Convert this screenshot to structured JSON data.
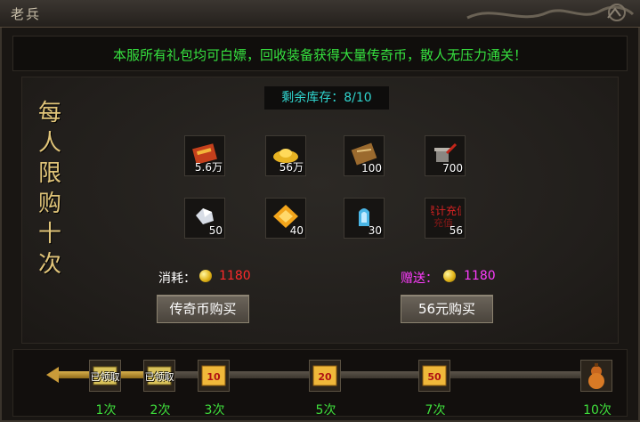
{
  "window": {
    "title": "老兵"
  },
  "notice": "本服所有礼包均可白嫖，回收装备获得大量传奇币，散人无压力通关！",
  "side_text": [
    "每",
    "人",
    "限",
    "购",
    "十",
    "次"
  ],
  "stock": {
    "label": "剩余库存：",
    "value": "8/10"
  },
  "items": [
    {
      "icon": "gift-scroll-icon",
      "qty": "5.6万"
    },
    {
      "icon": "gold-ingot-icon",
      "qty": "56万"
    },
    {
      "icon": "book-icon",
      "qty": "100"
    },
    {
      "icon": "anvil-icon",
      "qty": "700"
    },
    {
      "icon": "silver-crystal-icon",
      "qty": "50"
    },
    {
      "icon": "gold-gem-icon",
      "qty": "40"
    },
    {
      "icon": "blue-rune-icon",
      "qty": "30"
    },
    {
      "icon": "recharge-seal-icon",
      "qty": "56",
      "seal_text": "累计充值"
    }
  ],
  "cost": {
    "label": "消耗：",
    "value": "1180",
    "color": "#ff2a2a"
  },
  "bonus": {
    "label": "赠送：",
    "value": "1180",
    "color": "#ff3cff"
  },
  "buttons": {
    "buy_coin": "传奇币购买",
    "buy_cash": "56元购买"
  },
  "progress": {
    "filled_fraction": 0.2,
    "milestones": [
      {
        "count": "1次",
        "icon": "ticket-icon",
        "status": "已领取"
      },
      {
        "count": "2次",
        "icon": "ticket-icon",
        "status": "已领取"
      },
      {
        "count": "3次",
        "icon": "coupon-10-icon",
        "badge": "10"
      },
      {
        "count": "5次",
        "icon": "coupon-20-icon",
        "badge": "20"
      },
      {
        "count": "7次",
        "icon": "coupon-50-icon",
        "badge": "50"
      },
      {
        "count": "10次",
        "icon": "gourd-icon"
      }
    ]
  }
}
